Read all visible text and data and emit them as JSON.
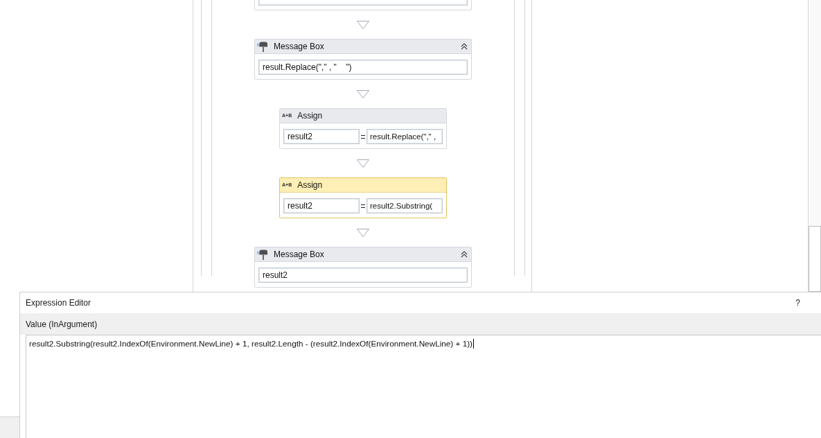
{
  "designer": {
    "activities": [
      {
        "kind": "partial",
        "selected": false
      },
      {
        "kind": "message_box",
        "title": "Message Box",
        "expanded": true,
        "selected": false,
        "text": "result.Replace(\",\" , \"    \")"
      },
      {
        "kind": "assign",
        "icon": "A+B",
        "title": "Assign",
        "selected": false,
        "to": "result2",
        "value": "result.Replace(\",\" ,"
      },
      {
        "kind": "assign",
        "icon": "A+B",
        "title": "Assign",
        "selected": true,
        "to": "result2",
        "value": "result2.Substring("
      },
      {
        "kind": "message_box",
        "title": "Message Box",
        "expanded": true,
        "selected": false,
        "text": "result2"
      }
    ]
  },
  "expression_editor": {
    "title": "Expression Editor",
    "help": "?",
    "label": "Value (InArgument)",
    "value": "result2.Substring(result2.IndexOf(Environment.NewLine) + 1, result2.Length - (result2.IndexOf(Environment.NewLine) + 1))",
    "focused": true
  }
}
